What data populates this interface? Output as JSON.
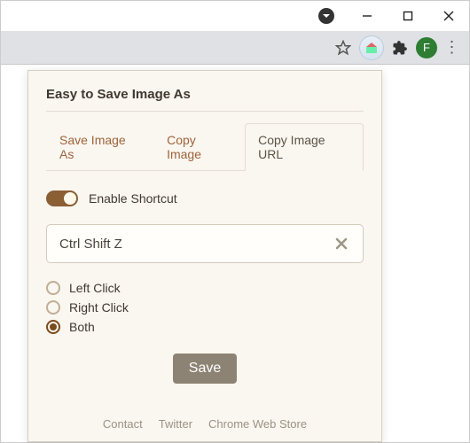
{
  "window": {
    "avatar_letter": "F"
  },
  "popup": {
    "title": "Easy to Save Image As",
    "tabs": [
      {
        "label": "Save Image As"
      },
      {
        "label": "Copy Image"
      },
      {
        "label": "Copy Image URL",
        "active": true
      }
    ],
    "toggle": {
      "label": "Enable Shortcut",
      "on": true
    },
    "shortcut": {
      "value": "Ctrl Shift Z"
    },
    "radios": [
      {
        "label": "Left Click",
        "checked": false
      },
      {
        "label": "Right Click",
        "checked": false
      },
      {
        "label": "Both",
        "checked": true
      }
    ],
    "save_label": "Save",
    "footer": [
      {
        "label": "Contact"
      },
      {
        "label": "Twitter"
      },
      {
        "label": "Chrome Web Store"
      }
    ]
  }
}
